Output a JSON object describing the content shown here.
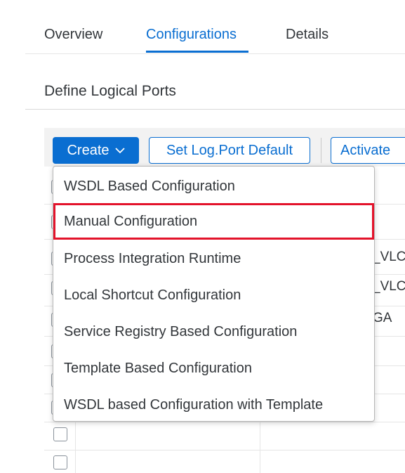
{
  "tabs": [
    {
      "label": "Overview"
    },
    {
      "label": "Configurations"
    },
    {
      "label": "Details"
    }
  ],
  "section": {
    "title": "Define Logical Ports"
  },
  "toolbar": {
    "create_label": "Create",
    "set_default_label": "Set Log.Port Default",
    "activate_label": "Activate"
  },
  "menu": {
    "items": [
      {
        "label": "WSDL Based Configuration"
      },
      {
        "label": "Manual Configuration"
      },
      {
        "label": "Process Integration Runtime"
      },
      {
        "label": "Local Shortcut Configuration"
      },
      {
        "label": "Service Registry Based Configuration"
      },
      {
        "label": "Template Based Configuration"
      },
      {
        "label": "WSDL based Configuration with Template"
      }
    ]
  },
  "table": {
    "partial_cells": [
      "_VLC",
      "_VLC",
      "GA"
    ]
  },
  "colors": {
    "accent": "#0a6ed1",
    "highlight": "#e3132b"
  }
}
